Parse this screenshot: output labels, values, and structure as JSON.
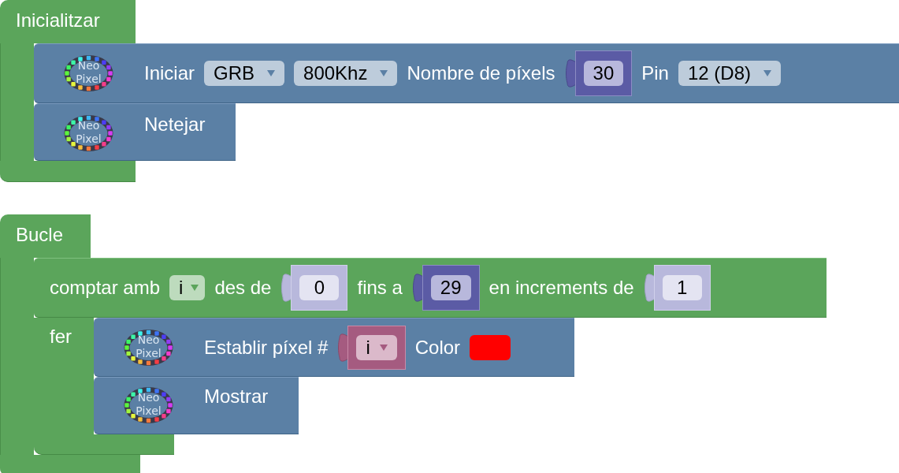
{
  "blocks": [
    {
      "kind": "event",
      "label": "Inicialitzar",
      "statements": [
        {
          "kind": "neopixel",
          "icon_text": [
            "Neo",
            "Pixel"
          ],
          "fields": [
            {
              "kind": "label",
              "text": "Iniciar"
            },
            {
              "kind": "dropdown",
              "text": "GRB"
            },
            {
              "kind": "dropdown",
              "text": "800Khz"
            },
            {
              "kind": "label",
              "text": "Nombre de píxels"
            },
            {
              "kind": "number",
              "text": "30",
              "shadow": false
            },
            {
              "kind": "label",
              "text": "Pin"
            },
            {
              "kind": "dropdown",
              "text": "12 (D8)"
            }
          ]
        },
        {
          "kind": "neopixel",
          "icon_text": [
            "Neo",
            "Pixel"
          ],
          "fields": [
            {
              "kind": "label",
              "text": "Netejar"
            }
          ]
        }
      ]
    },
    {
      "kind": "event",
      "label": "Bucle",
      "statements": [
        {
          "kind": "loop",
          "fields": [
            {
              "kind": "label",
              "text": "comptar amb"
            },
            {
              "kind": "dropdown",
              "text": "i"
            },
            {
              "kind": "label",
              "text": "des de"
            },
            {
              "kind": "number",
              "text": "0",
              "shadow": true
            },
            {
              "kind": "label",
              "text": "fins a"
            },
            {
              "kind": "number",
              "text": "29",
              "shadow": false
            },
            {
              "kind": "label",
              "text": "en increments de"
            },
            {
              "kind": "number",
              "text": "1",
              "shadow": true
            }
          ],
          "do_label": "fer",
          "statements": [
            {
              "kind": "neopixel",
              "icon_text": [
                "Neo",
                "Pixel"
              ],
              "fields": [
                {
                  "kind": "label",
                  "text": "Establir píxel #"
                },
                {
                  "kind": "variable",
                  "text": "i"
                },
                {
                  "kind": "label",
                  "text": "Color"
                },
                {
                  "kind": "colour",
                  "color": "#ff0000"
                }
              ]
            },
            {
              "kind": "neopixel",
              "icon_text": [
                "Neo",
                "Pixel"
              ],
              "fields": [
                {
                  "kind": "label",
                  "text": "Mostrar"
                }
              ]
            }
          ]
        }
      ]
    }
  ]
}
